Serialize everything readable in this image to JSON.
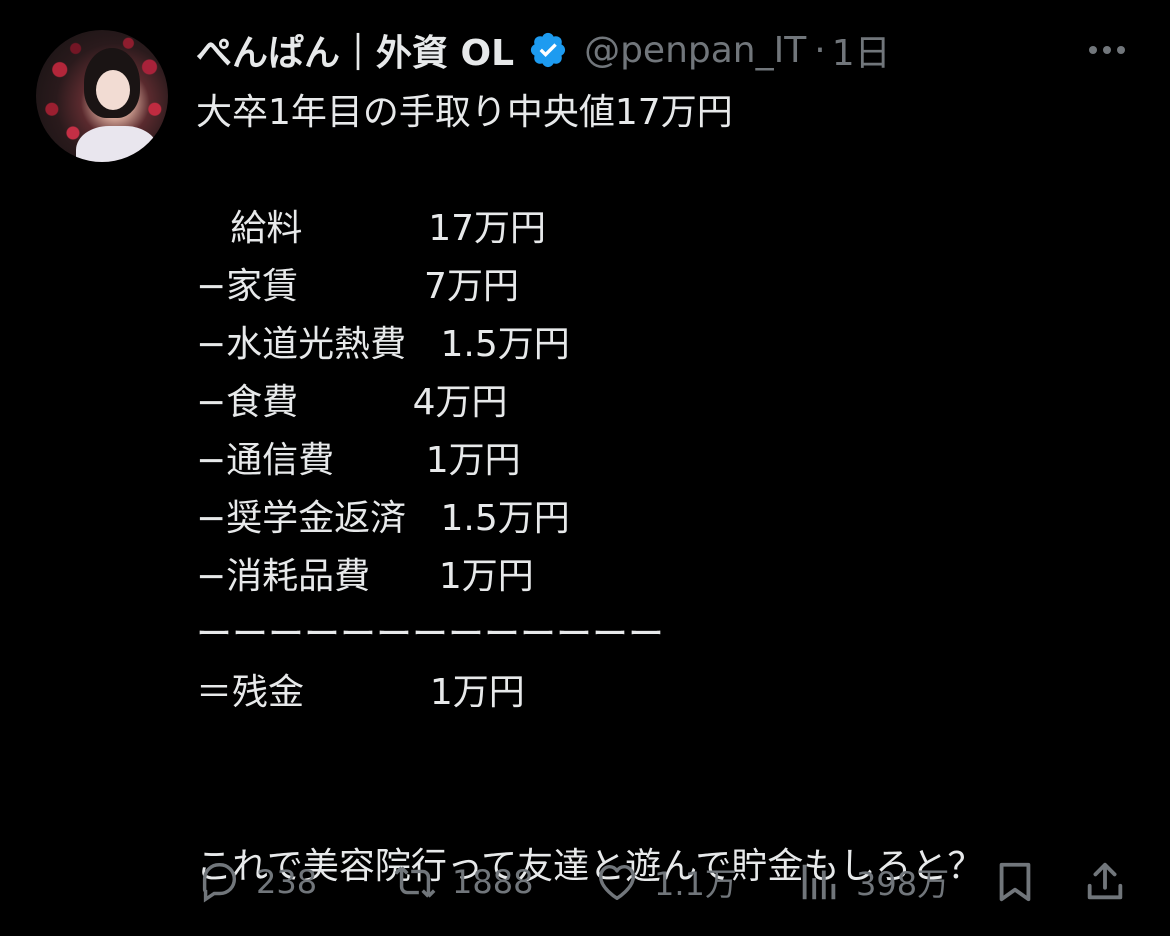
{
  "author": {
    "display_name": "ぺんぱん｜外資 OL",
    "handle": "@penpan_IT",
    "dot": "·",
    "time": "1日",
    "avatar_icon": "avatar-photo",
    "verified_icon": "verified-badge-icon",
    "verified_color": "#1d9bf0"
  },
  "tweet": {
    "lines": [
      "大卒1年目の手取り中央値17万円",
      "",
      "   給料           17万円",
      "−家賃           7万円",
      "−水道光熱費   1.5万円",
      "−食費          4万円",
      "−通信費        1万円",
      "−奨学金返済   1.5万円",
      "−消耗品費      1万円",
      "ーーーーーーーーーーーーー",
      "＝残金           1万円",
      "",
      "",
      "これで美容院行って友達と遊んで貯金もしろと？"
    ]
  },
  "actions": {
    "replies": "238",
    "retweets": "1888",
    "likes": "1.1万",
    "views": "398万"
  },
  "colors": {
    "background": "#000000",
    "text": "#e7e9ea",
    "muted": "#71767b"
  }
}
